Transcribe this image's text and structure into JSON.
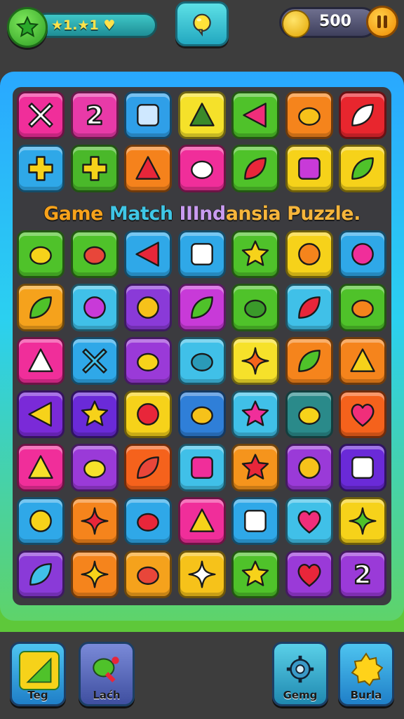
{
  "top_bar": {
    "level_label": "★1.★1 ♥",
    "coins": "500"
  },
  "board": {
    "title_parts": [
      "Game ",
      "Match ",
      "IIInd",
      "ansia Puzzle."
    ],
    "rows": [
      [
        {
          "color": "#f02e9a",
          "icon": "arrows-icon"
        },
        {
          "color": "#e83aa8",
          "icon": "number-two-icon"
        },
        {
          "color": "#2f9fe8",
          "icon": "phone-icon"
        },
        {
          "color": "#f5e12a",
          "icon": "triangle-icon"
        },
        {
          "color": "#4fc22a",
          "icon": "play-triangle-icon"
        },
        {
          "color": "#f5841c",
          "icon": "bird-icon"
        },
        {
          "color": "#e8262e",
          "icon": "slash-icon"
        }
      ],
      [
        {
          "color": "#2fa8e8",
          "icon": "hammer-icon"
        },
        {
          "color": "#4ab82a",
          "icon": "plus-icon"
        },
        {
          "color": "#f5821c",
          "icon": "basket-icon"
        },
        {
          "color": "#f02e9a",
          "icon": "cloud-icon"
        },
        {
          "color": "#4fc22a",
          "icon": "lobster-icon"
        },
        {
          "color": "#f6d21a",
          "icon": "pot-icon"
        },
        {
          "color": "#f6d21a",
          "icon": "leaf-icon"
        }
      ],
      [
        {
          "color": "#4fc22a",
          "icon": "jellyfish-icon"
        },
        {
          "color": "#4fc22a",
          "icon": "fish-icon"
        },
        {
          "color": "#2fa8e8",
          "icon": "arrow-icon"
        },
        {
          "color": "#2fa8e8",
          "icon": "squares-icon"
        },
        {
          "color": "#4fc22a",
          "icon": "star-icon"
        },
        {
          "color": "#f6d21a",
          "icon": "sun-face-icon"
        },
        {
          "color": "#2fa8e8",
          "icon": "ball-icon"
        }
      ],
      [
        {
          "color": "#f5a21c",
          "icon": "heart-leaf-icon"
        },
        {
          "color": "#40c0e8",
          "icon": "no-sign-icon"
        },
        {
          "color": "#8a3ad8",
          "icon": "ring-icon"
        },
        {
          "color": "#c83ad8",
          "icon": "palm-tree-icon"
        },
        {
          "color": "#4fc22a",
          "icon": "turtle-icon"
        },
        {
          "color": "#40c0e8",
          "icon": "pencil-icon"
        },
        {
          "color": "#4fc22a",
          "icon": "mango-icon"
        }
      ],
      [
        {
          "color": "#f02e9a",
          "icon": "sail-icon"
        },
        {
          "color": "#2fa8e8",
          "icon": "cross-icon"
        },
        {
          "color": "#9a3ad8",
          "icon": "duck-icon"
        },
        {
          "color": "#40c0e8",
          "icon": "rabbit-icon"
        },
        {
          "color": "#f6e12a",
          "icon": "flower-icon"
        },
        {
          "color": "#f5841c",
          "icon": "leaf-green-icon"
        },
        {
          "color": "#f5841c",
          "icon": "triangle-outline-icon"
        }
      ],
      [
        {
          "color": "#7a2ad8",
          "icon": "left-triangle-icon"
        },
        {
          "color": "#6a2ad8",
          "icon": "star-yellow-icon"
        },
        {
          "color": "#f6d21a",
          "icon": "apple-icon"
        },
        {
          "color": "#2f7fd8",
          "icon": "bug-icon"
        },
        {
          "color": "#40c0e8",
          "icon": "star-pink-icon"
        },
        {
          "color": "#2a8a8a",
          "icon": "blob-icon"
        },
        {
          "color": "#f5621c",
          "icon": "heart-icon"
        }
      ],
      [
        {
          "color": "#f02e9a",
          "icon": "triangle-yellow-icon"
        },
        {
          "color": "#9a3ad8",
          "icon": "thumb-icon"
        },
        {
          "color": "#f5621c",
          "icon": "leaf-red-icon"
        },
        {
          "color": "#40c0e8",
          "icon": "cup-icon"
        },
        {
          "color": "#f5941c",
          "icon": "star-red-icon"
        },
        {
          "color": "#9a3ad8",
          "icon": "key-icon"
        },
        {
          "color": "#6a2ad8",
          "icon": "cube-icon"
        }
      ],
      [
        {
          "color": "#2fa8e8",
          "icon": "pin-icon"
        },
        {
          "color": "#f5841c",
          "icon": "germ-icon"
        },
        {
          "color": "#2fa8e8",
          "icon": "strawberry-icon"
        },
        {
          "color": "#f02e9a",
          "icon": "flag-icon"
        },
        {
          "color": "#2fa8e8",
          "icon": "window-icon"
        },
        {
          "color": "#40c0e8",
          "icon": "shield-icon"
        },
        {
          "color": "#f6d21a",
          "icon": "sparkle-green-icon"
        }
      ],
      [
        {
          "color": "#8a3ad8",
          "icon": "pen-icon"
        },
        {
          "color": "#f5841c",
          "icon": "gear-sun-icon"
        },
        {
          "color": "#f5a21c",
          "icon": "bell-icon"
        },
        {
          "color": "#f6c21a",
          "icon": "sparkle-icon"
        },
        {
          "color": "#4fc22a",
          "icon": "star-gold-icon"
        },
        {
          "color": "#9a3ad8",
          "icon": "berry-icon"
        },
        {
          "color": "#9a3ad8",
          "icon": "number-two-icon"
        }
      ]
    ]
  },
  "bottom_buttons": [
    {
      "label": "Teg",
      "icon": "triangle-card-icon",
      "color": "#2fa8e8"
    },
    {
      "label": "Laćh",
      "icon": "paint-icon",
      "color": "#5a6fb8"
    },
    {
      "label": "Gemg",
      "icon": "gear-icon",
      "color": "#2fa8c8"
    },
    {
      "label": "Burla",
      "icon": "sun-badge-icon",
      "color": "#2fa8e8"
    }
  ],
  "colors": {
    "background": "#3d3d3d",
    "board_frame_top": "#29a8ff",
    "board_frame_bottom": "#5ed36a"
  }
}
